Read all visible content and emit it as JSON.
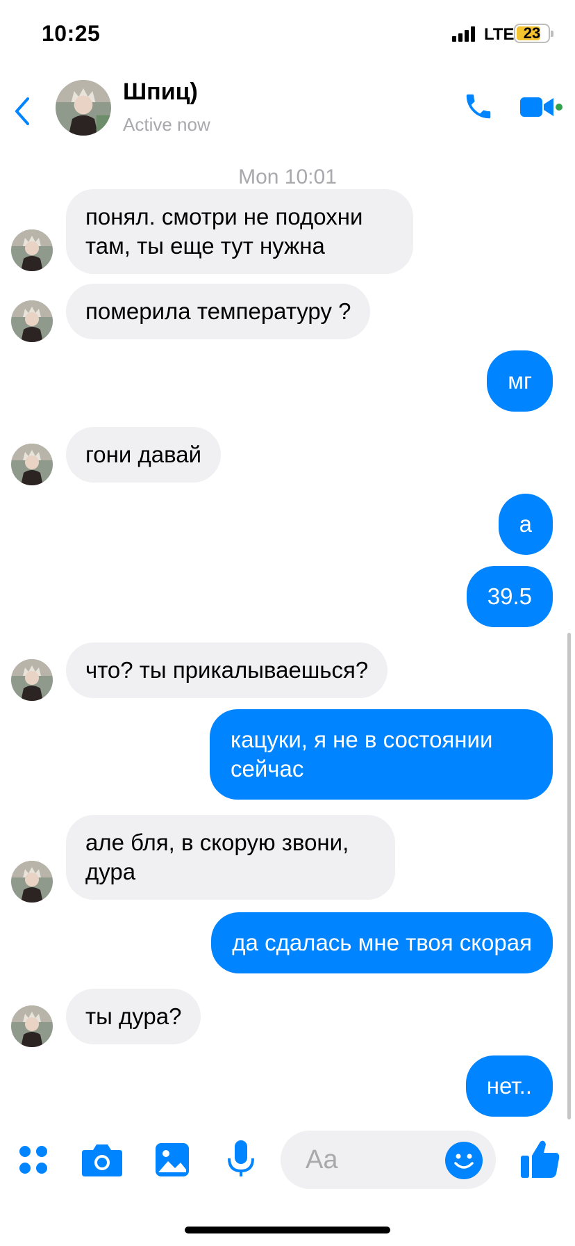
{
  "status_bar": {
    "time": "10:25",
    "network": "LTE",
    "battery_level": "23",
    "battery_color": "#f4c430"
  },
  "header": {
    "contact_name": "Шпиц)",
    "contact_status": "Active now",
    "icons": [
      "back-chevron-icon",
      "phone-icon",
      "video-camera-icon"
    ],
    "accent_color": "#0084ff",
    "online_indicator_color": "#31a24c"
  },
  "chat": {
    "timestamp": "Mon 10:01",
    "messages": [
      {
        "from": "contact",
        "text": "понял. смотри не подохни там, ты еще тут нужна"
      },
      {
        "from": "contact",
        "text": "померила температуру ?"
      },
      {
        "from": "me",
        "text": "мг"
      },
      {
        "from": "contact",
        "text": "гони давай"
      },
      {
        "from": "me",
        "text": "а"
      },
      {
        "from": "me",
        "text": "39.5"
      },
      {
        "from": "contact",
        "text": "что? ты прикалываешься?"
      },
      {
        "from": "me",
        "text": "кацуки, я не в состоянии сейчас"
      },
      {
        "from": "contact",
        "text": "але бля, в скорую звони, дура"
      },
      {
        "from": "me",
        "text": "да сдалась мне твоя скорая"
      },
      {
        "from": "contact",
        "text": "ты дура?"
      },
      {
        "from": "me",
        "text": "нет.."
      }
    ]
  },
  "composer": {
    "placeholder": "Aa",
    "icons": [
      "apps-grid-icon",
      "camera-icon",
      "gallery-icon",
      "microphone-icon",
      "emoji-icon",
      "thumbs-up-icon"
    ]
  }
}
